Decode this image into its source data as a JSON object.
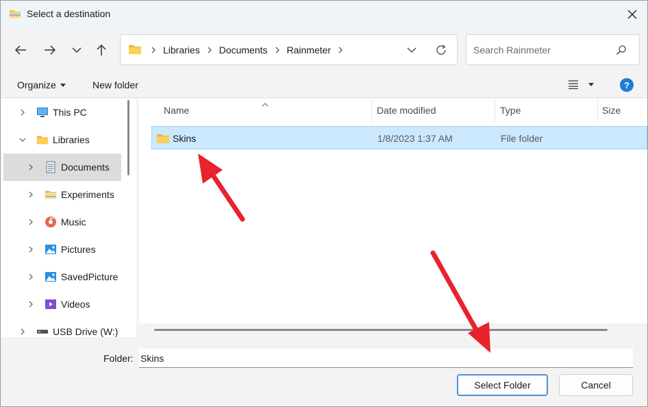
{
  "window": {
    "title": "Select a destination"
  },
  "address": {
    "crumbs": [
      "Libraries",
      "Documents",
      "Rainmeter"
    ]
  },
  "search": {
    "placeholder": "Search Rainmeter"
  },
  "toolbar": {
    "organize": "Organize",
    "new_folder": "New folder",
    "help": "?"
  },
  "nav": {
    "items": [
      {
        "label": "This PC",
        "icon": "pc-icon",
        "expanded": false
      },
      {
        "label": "Libraries",
        "icon": "folder-icon",
        "expanded": true
      },
      {
        "label": "Documents",
        "icon": "documents-icon",
        "expanded": false,
        "selected": true
      },
      {
        "label": "Experiments",
        "icon": "folder-icon",
        "expanded": false
      },
      {
        "label": "Music",
        "icon": "music-icon",
        "expanded": false
      },
      {
        "label": "Pictures",
        "icon": "pictures-icon",
        "expanded": false
      },
      {
        "label": "SavedPicture",
        "icon": "pictures-icon",
        "expanded": false
      },
      {
        "label": "Videos",
        "icon": "videos-icon",
        "expanded": false
      },
      {
        "label": "USB Drive (W:)",
        "icon": "drive-icon",
        "expanded": false
      }
    ]
  },
  "columns": {
    "name": "Name",
    "date": "Date modified",
    "type": "Type",
    "size": "Size"
  },
  "files": [
    {
      "name": "Skins",
      "date": "1/8/2023 1:37 AM",
      "type": "File folder",
      "selected": true
    }
  ],
  "footer": {
    "folder_label": "Folder:",
    "folder_value": "Skins",
    "select_button": "Select Folder",
    "cancel_button": "Cancel"
  },
  "colors": {
    "selection_bg": "#cce8ff",
    "accent": "#1e7bd6",
    "annotation_arrow": "#e8232e"
  }
}
